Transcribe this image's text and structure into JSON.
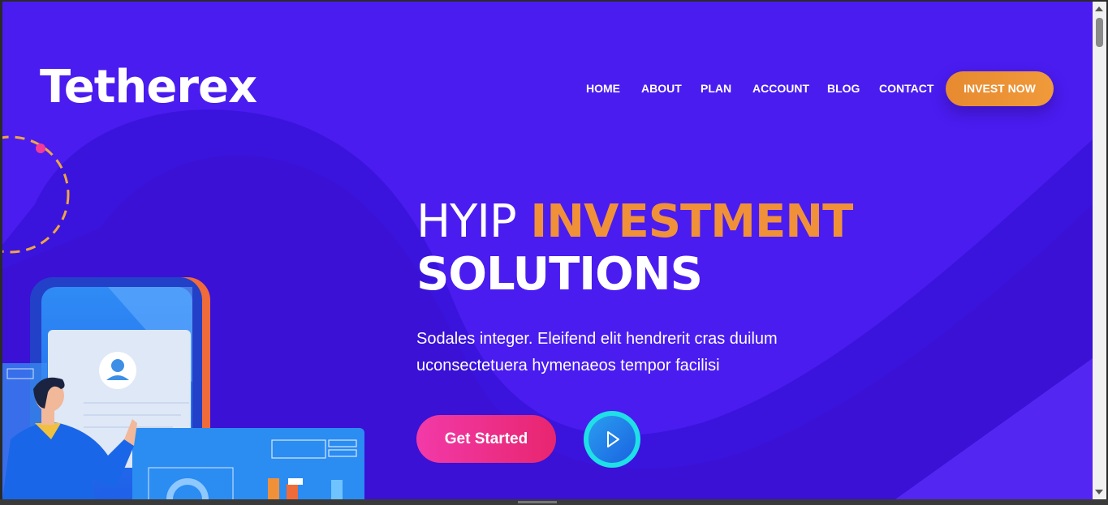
{
  "brand": {
    "logo_text": "Tetherex"
  },
  "nav": {
    "items": [
      {
        "label": "HOME"
      },
      {
        "label": "ABOUT"
      },
      {
        "label": "PLAN"
      },
      {
        "label": "ACCOUNT"
      },
      {
        "label": "BLOG"
      },
      {
        "label": "CONTACT"
      }
    ],
    "cta_label": "INVEST NOW"
  },
  "hero": {
    "title_part1": "HYIP",
    "title_part2": "INVESTMENT",
    "title_line2": "SOLUTIONS",
    "description": "Sodales integer. Eleifend elit hendrerit cras duilum uconsectetuera hymenaeos tempor facilisi",
    "primary_button": "Get Started",
    "play_button_icon": "play-icon"
  },
  "colors": {
    "background": "#4a1cf0",
    "accent_orange": "#f0913a",
    "cta_pink": "#e8256f",
    "play_cyan": "#1ee0e6"
  }
}
